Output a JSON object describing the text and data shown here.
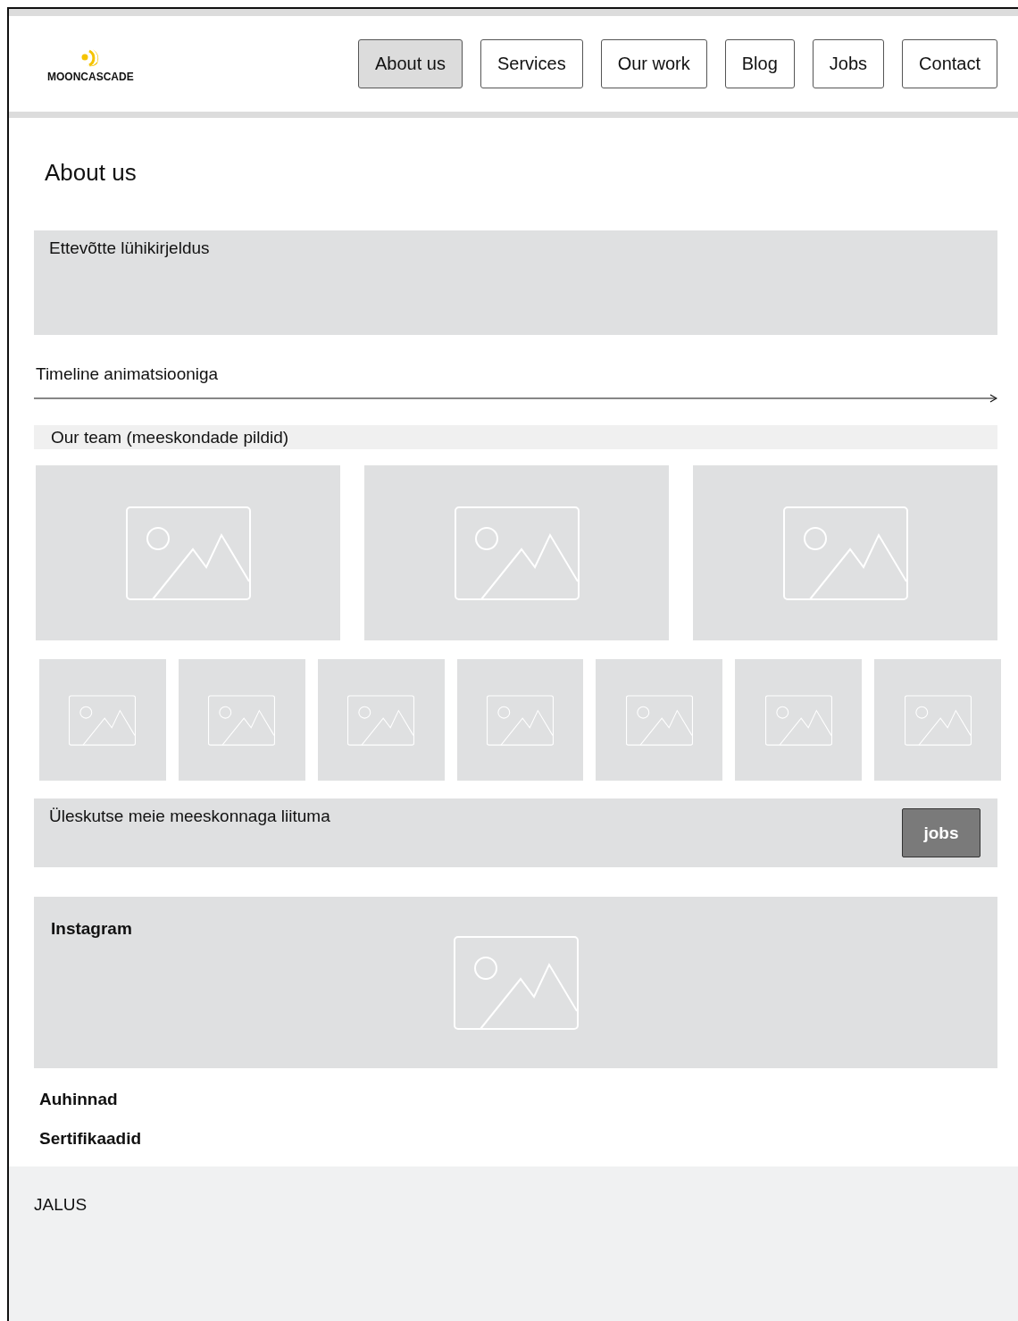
{
  "header": {
    "logo": "MOONCASCADE",
    "nav": [
      {
        "label": "About us",
        "selected": true
      },
      {
        "label": "Services",
        "selected": false
      },
      {
        "label": "Our work",
        "selected": false
      },
      {
        "label": "Blog",
        "selected": false
      },
      {
        "label": "Jobs",
        "selected": false
      },
      {
        "label": "Contact",
        "selected": false
      }
    ]
  },
  "page_title": "About us",
  "intro": {
    "text": "Ettevõtte lühikirjeldus"
  },
  "timeline": {
    "label": "Timeline animatsiooniga"
  },
  "team": {
    "heading": "Our team (meeskondade pildid)",
    "large_images": [
      {
        "kind": "placeholder"
      },
      {
        "kind": "placeholder"
      },
      {
        "kind": "placeholder"
      }
    ],
    "small_images": [
      {
        "kind": "placeholder"
      },
      {
        "kind": "placeholder"
      },
      {
        "kind": "placeholder"
      },
      {
        "kind": "placeholder"
      },
      {
        "kind": "placeholder"
      },
      {
        "kind": "placeholder"
      },
      {
        "kind": "placeholder"
      }
    ]
  },
  "join": {
    "text": "Üleskutse meie meeskonnaga liituma",
    "button": "jobs"
  },
  "instagram": {
    "heading": "Instagram",
    "image": {
      "kind": "placeholder"
    }
  },
  "awards": "Auhinnad",
  "certificates": "Sertifikaadid",
  "footer": {
    "text": "JALUS"
  }
}
